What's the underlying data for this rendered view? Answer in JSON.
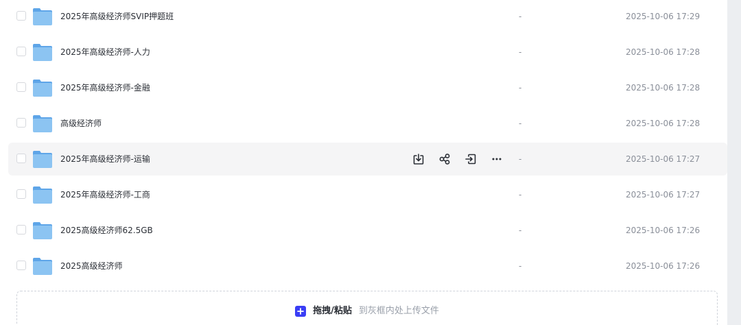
{
  "files": [
    {
      "name": "2025年高级经济师SVIP押题班",
      "size": "-",
      "modified": "2025-10-06 17:29"
    },
    {
      "name": "2025年高级经济师-人力",
      "size": "-",
      "modified": "2025-10-06 17:28"
    },
    {
      "name": "2025年高级经济师-金融",
      "size": "-",
      "modified": "2025-10-06 17:28"
    },
    {
      "name": "高级经济师",
      "size": "-",
      "modified": "2025-10-06 17:28"
    },
    {
      "name": "2025年高级经济师-运输",
      "size": "-",
      "modified": "2025-10-06 17:27"
    },
    {
      "name": "2025年高级经济师-工商",
      "size": "-",
      "modified": "2025-10-06 17:27"
    },
    {
      "name": "2025高级经济师62.5GB",
      "size": "-",
      "modified": "2025-10-06 17:26"
    },
    {
      "name": "2025高级经济师",
      "size": "-",
      "modified": "2025-10-06 17:26"
    }
  ],
  "hovered_row_actions": [
    "download-icon",
    "share-icon",
    "move-icon",
    "more-icon"
  ],
  "upload": {
    "label": "拖拽/粘贴",
    "hint": "到灰框内处上传文件"
  },
  "colors": {
    "accent": "#3a3ef5",
    "folder": "#7cb8ec",
    "hover_bg": "#f5f5f6"
  }
}
